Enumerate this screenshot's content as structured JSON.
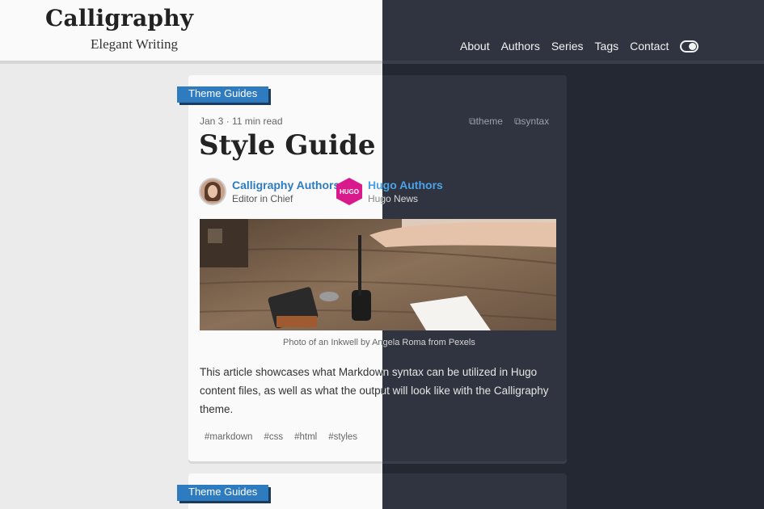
{
  "site": {
    "title": "Calligraphy",
    "subtitle": "Elegant Writing"
  },
  "nav": {
    "items": [
      "About",
      "Authors",
      "Series",
      "Tags",
      "Contact"
    ]
  },
  "post": {
    "category": "Theme Guides",
    "meta": "Jan 3 · 11 min read",
    "categories": [
      "theme",
      "syntax"
    ],
    "title": "Style Guide",
    "authors": [
      {
        "name": "Calligraphy Authors",
        "role": "Editor in Chief"
      },
      {
        "name": "Hugo Authors",
        "role": "Hugo News",
        "logo": "HUGO"
      }
    ],
    "image_caption": "Photo of an Inkwell by Angela Roma from Pexels",
    "summary": "This article showcases what Markdown syntax can be utilized in Hugo content files, as well as what the output will look like with the Calligraphy theme.",
    "tags": [
      "#markdown",
      "#css",
      "#html",
      "#styles"
    ]
  },
  "next_post": {
    "category": "Theme Guides"
  },
  "colors": {
    "accent": "#2f7bbf",
    "dark_bg": "#242833",
    "dark_panel": "#303441",
    "light_bg": "#ebebeb"
  }
}
